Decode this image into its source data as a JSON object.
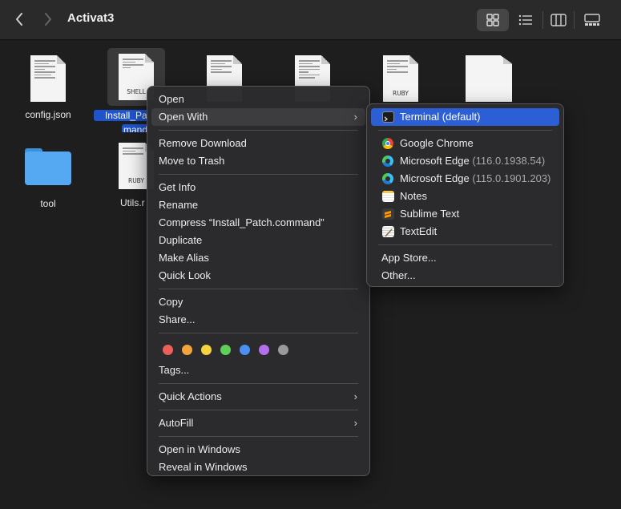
{
  "window": {
    "title": "Activat3"
  },
  "files": [
    {
      "name": "config.json",
      "kind": "doc",
      "tag": ""
    },
    {
      "name": "Install_Patch.command",
      "kind": "doc",
      "tag": "SHELL",
      "label_line1": "Install_Patc",
      "label_line2": "mand"
    },
    {
      "name": "",
      "kind": "doc",
      "tag": ""
    },
    {
      "name": "",
      "kind": "doc",
      "tag": ""
    },
    {
      "name": "",
      "kind": "doc",
      "tag": "RUBY"
    },
    {
      "name": "",
      "kind": "doc",
      "tag": ""
    },
    {
      "name": "tool",
      "kind": "folder",
      "tag": ""
    },
    {
      "name": "Utils.r",
      "kind": "doc",
      "tag": "RUBY"
    }
  ],
  "context_menu": {
    "open": "Open",
    "open_with": "Open With",
    "remove_download": "Remove Download",
    "move_to_trash": "Move to Trash",
    "get_info": "Get Info",
    "rename": "Rename",
    "compress": "Compress “Install_Patch.command”",
    "duplicate": "Duplicate",
    "make_alias": "Make Alias",
    "quick_look": "Quick Look",
    "copy": "Copy",
    "share": "Share...",
    "tag_colors": [
      "#ec5f59",
      "#f3a53c",
      "#f5d33c",
      "#5fcf5a",
      "#4b8ff3",
      "#b470ec",
      "#9a9a9a"
    ],
    "tags": "Tags...",
    "quick_actions": "Quick Actions",
    "autofill": "AutoFill",
    "open_in_windows": "Open in Windows",
    "reveal_in_windows": "Reveal in Windows"
  },
  "open_with_submenu": {
    "terminal": {
      "name": "Terminal (default)",
      "icon": "terminal-icon"
    },
    "chrome": {
      "name": "Google Chrome",
      "icon": "chrome-icon"
    },
    "edge1": {
      "name": "Microsoft Edge",
      "version": "(116.0.1938.54)",
      "icon": "edge-icon"
    },
    "edge2": {
      "name": "Microsoft Edge",
      "version": "(115.0.1901.203)",
      "icon": "edge-icon"
    },
    "notes": {
      "name": "Notes",
      "icon": "notes-icon"
    },
    "sublime": {
      "name": "Sublime Text",
      "icon": "sublime-icon"
    },
    "textedit": {
      "name": "TextEdit",
      "icon": "textedit-icon"
    },
    "app_store": "App Store...",
    "other": "Other..."
  },
  "colors": {
    "accent": "#2c5fd6",
    "selection": "#1f54cc"
  }
}
